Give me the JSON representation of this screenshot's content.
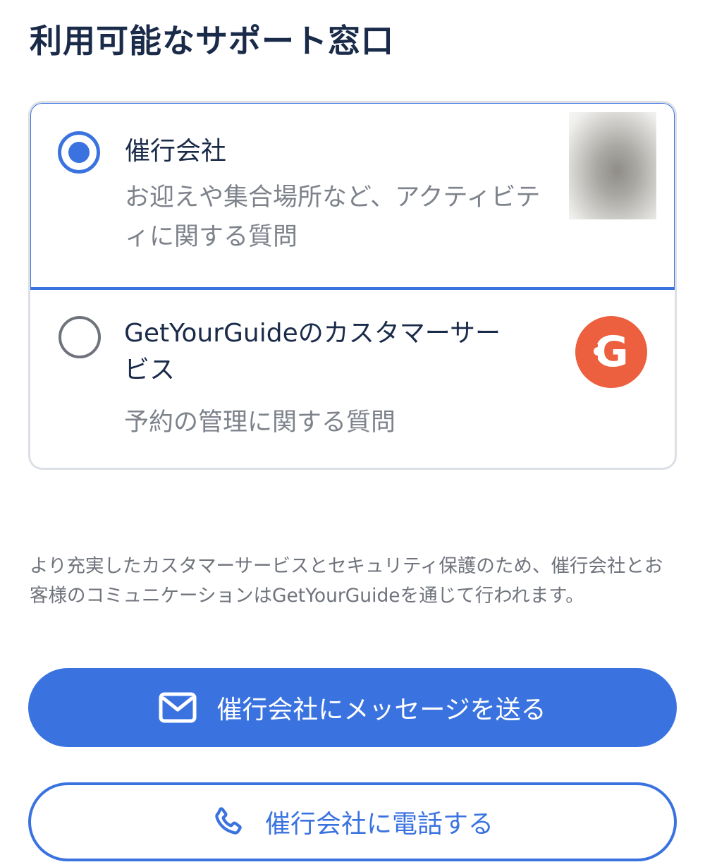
{
  "page": {
    "title": "利用可能なサポート窓口"
  },
  "options": [
    {
      "title": "催行会社",
      "description": "お迎えや集合場所など、アクティビティに関する質問",
      "selected": true,
      "image": "blurred-thumbnail"
    },
    {
      "title": "GetYourGuideのカスタマーサービス",
      "description": "予約の管理に関する質問",
      "selected": false,
      "logo_letter": "G",
      "logo_color": "#ec5f3f"
    }
  ],
  "notice": "より充実したカスタマーサービスとセキュリティ保護のため、催行会社とお客様のコミュニケーションはGetYourGuideを通じて行われます。",
  "buttons": {
    "message_label": "催行会社にメッセージを送る",
    "message_icon": "mail-icon",
    "call_label": "催行会社に電話する",
    "call_icon": "phone-icon"
  },
  "colors": {
    "accent": "#3a73e0",
    "title_text": "#1a2b49",
    "secondary_text": "#7d828b",
    "brand_logo": "#ec5f3f"
  }
}
